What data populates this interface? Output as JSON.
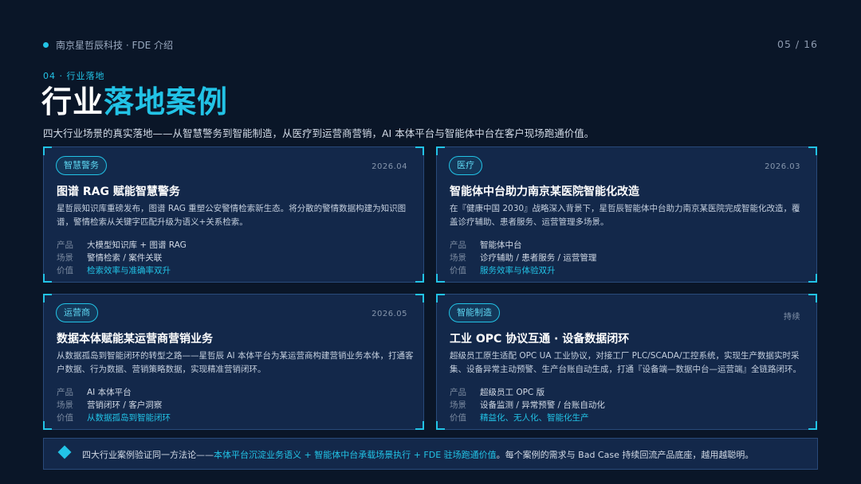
{
  "header": {
    "company": "南京星哲辰科技 · FDE 介绍",
    "page": "05 / 16"
  },
  "section_label": "04 · 行业落地",
  "title": {
    "part1": "行业",
    "part2": "落地案例"
  },
  "subtitle": "四大行业场景的真实落地——从智慧警务到智能制造，从医疗到运营商营销，AI 本体平台与智能体中台在客户现场跑通价值。",
  "cases": [
    {
      "tag": "智慧警务",
      "date": "2026.04",
      "title": "图谱 RAG 赋能智慧警务",
      "desc": "星哲辰知识库重磅发布，图谱 RAG 重塑公安警情检索新生态。将分散的警情数据构建为知识图谱，警情检索从关键字匹配升级为语义+关系检索。",
      "rows": [
        {
          "k": "产品",
          "v": "大模型知识库 + 图谱 RAG"
        },
        {
          "k": "场景",
          "v": "警情检索 / 案件关联"
        },
        {
          "k": "价值",
          "v": "检索效率与准确率双升"
        }
      ]
    },
    {
      "tag": "医疗",
      "date": "2026.03",
      "title": "智能体中台助力南京某医院智能化改造",
      "desc": "在『健康中国 2030』战略深入背景下，星哲辰智能体中台助力南京某医院完成智能化改造，覆盖诊疗辅助、患者服务、运营管理多场景。",
      "rows": [
        {
          "k": "产品",
          "v": "智能体中台"
        },
        {
          "k": "场景",
          "v": "诊疗辅助 / 患者服务 / 运营管理"
        },
        {
          "k": "价值",
          "v": "服务效率与体验双升"
        }
      ]
    },
    {
      "tag": "运营商",
      "date": "2026.05",
      "title": "数据本体赋能某运营商营销业务",
      "desc": "从数据孤岛到智能闭环的转型之路——星哲辰 AI 本体平台为某运营商构建营销业务本体，打通客户数据、行为数据、营销策略数据，实现精准营销闭环。",
      "rows": [
        {
          "k": "产品",
          "v": "AI 本体平台"
        },
        {
          "k": "场景",
          "v": "营销闭环 / 客户洞察"
        },
        {
          "k": "价值",
          "v": "从数据孤岛到智能闭环"
        }
      ]
    },
    {
      "tag": "智能制造",
      "date": "持续",
      "title": "工业 OPC 协议互通 · 设备数据闭环",
      "desc": "超级员工原生适配 OPC UA 工业协议，对接工厂 PLC/SCADA/工控系统，实现生产数据实时采集、设备异常主动预警、生产台账自动生成，打通『设备端—数据中台—运营端』全链路闭环。",
      "rows": [
        {
          "k": "产品",
          "v": "超级员工 OPC 版"
        },
        {
          "k": "场景",
          "v": "设备监测 / 异常预警 / 台账自动化"
        },
        {
          "k": "价值",
          "v": "精益化、无人化、智能化生产"
        }
      ]
    }
  ],
  "footer": {
    "part1": "四大行业案例验证同一方法论——",
    "part2": "本体平台沉淀业务语义 + 智能体中台承载场景执行 + FDE 驻场跑通价值",
    "part3": "。每个案例的需求与 Bad Case 持续回流产品底座，越用越聪明。"
  },
  "colors": {
    "background": "#0a1628",
    "card": "#13284a",
    "accent": "#22c3e6"
  }
}
